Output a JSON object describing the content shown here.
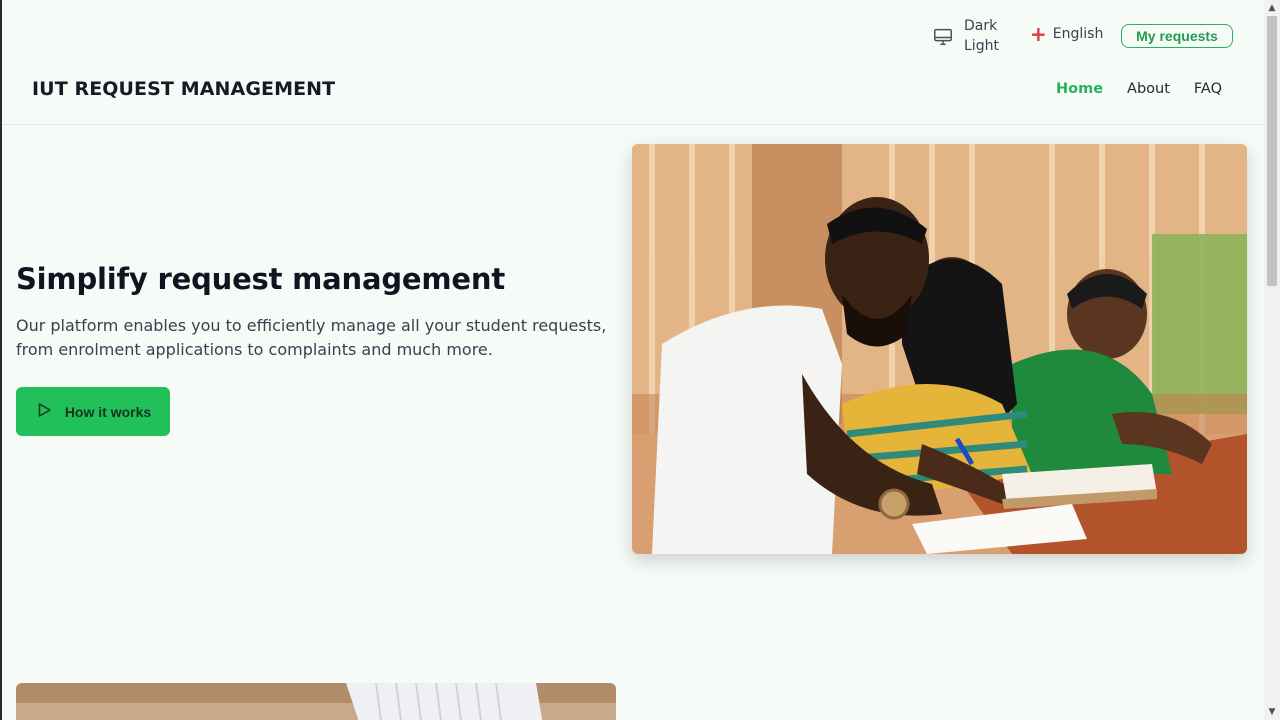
{
  "topbar": {
    "theme": {
      "dark_label": "Dark",
      "light_label": "Light"
    },
    "language": {
      "label": "English"
    },
    "my_requests_label": "My requests"
  },
  "navbar": {
    "brand": "IUT REQUEST MANAGEMENT",
    "links": [
      {
        "label": "Home",
        "active": true
      },
      {
        "label": "About",
        "active": false
      },
      {
        "label": "FAQ",
        "active": false
      }
    ]
  },
  "hero": {
    "title": "Simplify request management",
    "description": "Our platform enables you to efficiently manage all your student requests, from enrolment applications to complaints and much more.",
    "cta_label": "How it works"
  },
  "colors": {
    "accent": "#22c05a",
    "background": "#f6fbf7"
  }
}
